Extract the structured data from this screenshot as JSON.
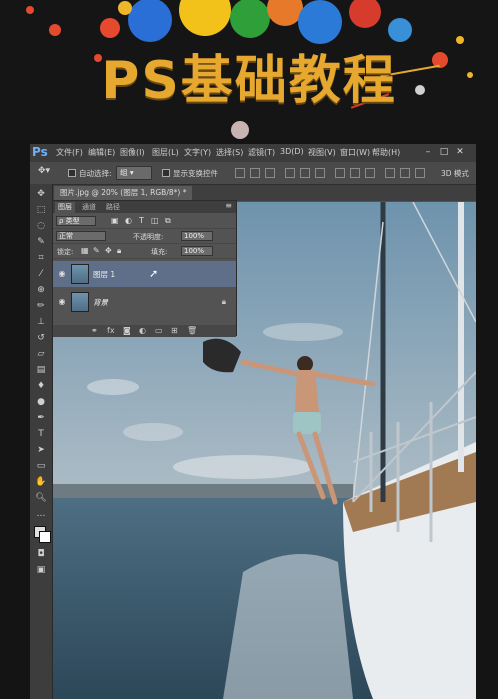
{
  "banner": {
    "title": "PS基础教程"
  },
  "app": {
    "logo": "Ps"
  },
  "menu": [
    "文件(F)",
    "编辑(E)",
    "图像(I)",
    "图层(L)",
    "文字(Y)",
    "选择(S)",
    "滤镜(T)",
    "3D(D)",
    "视图(V)",
    "窗口(W)",
    "帮助(H)"
  ],
  "options": {
    "auto_select_label": "自动选择:",
    "auto_select_value": "组",
    "show_transform_label": "显示变换控件",
    "mode_3d_label": "3D 模式"
  },
  "document": {
    "tab_label": "图片.jpg @ 20% (图层 1, RGB/8*) *"
  },
  "layers": {
    "tabs": [
      "图层",
      "通道",
      "路径"
    ],
    "kind_filter": "ρ 类型",
    "blend_mode": "正常",
    "opacity_label": "不透明度:",
    "opacity_value": "100%",
    "lock_label": "锁定:",
    "fill_label": "填充:",
    "fill_value": "100%",
    "items": [
      {
        "name": "图层 1",
        "selected": true
      },
      {
        "name": "背景",
        "locked": true
      }
    ]
  },
  "colors": {
    "accent": "#e7a830",
    "ps_blue": "#6fb0f5",
    "panel": "#535353",
    "selected_layer": "#5f6f8a"
  }
}
